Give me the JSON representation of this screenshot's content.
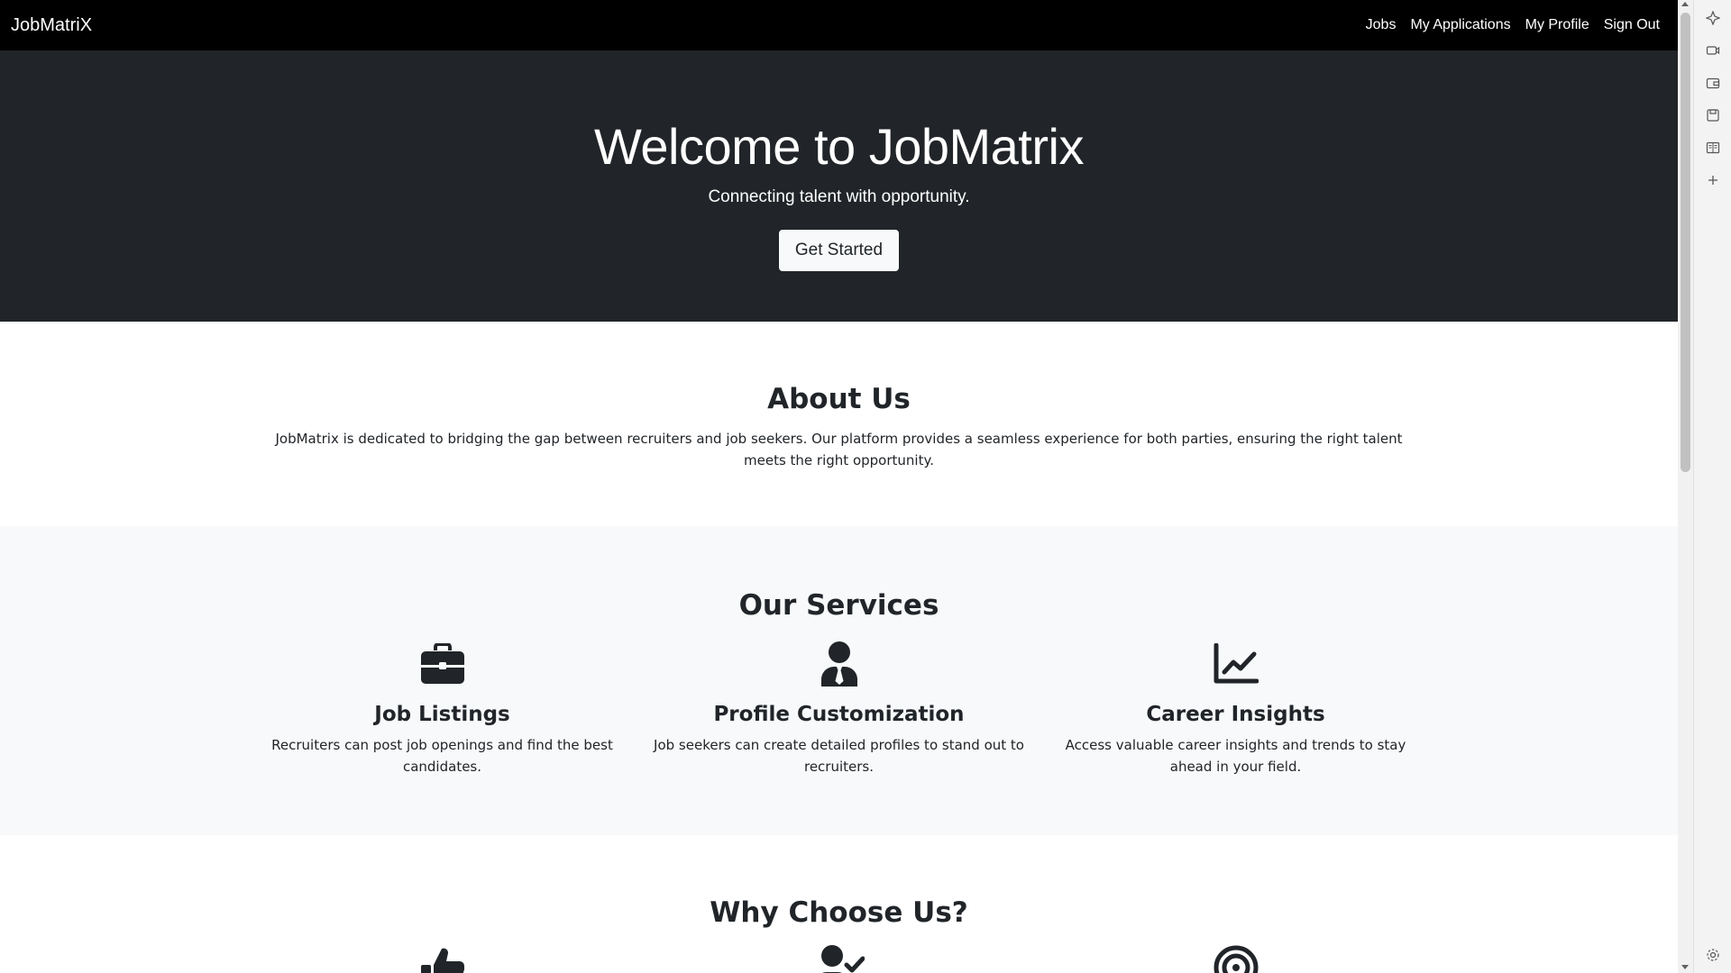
{
  "navbar": {
    "brand": "JobMatriX",
    "links": [
      "Jobs",
      "My Applications",
      "My Profile",
      "Sign Out"
    ]
  },
  "hero": {
    "title": "Welcome to JobMatrix",
    "subtitle": "Connecting talent with opportunity.",
    "cta_label": "Get Started"
  },
  "about": {
    "title": "About Us",
    "text": "JobMatrix is dedicated to bridging the gap between recruiters and job seekers. Our platform provides a seamless experience for both parties, ensuring the right talent meets the right opportunity."
  },
  "services": {
    "title": "Our Services",
    "items": [
      {
        "icon": "briefcase-icon",
        "title": "Job Listings",
        "text": "Recruiters can post job openings and find the best candidates."
      },
      {
        "icon": "person-tie-icon",
        "title": "Profile Customization",
        "text": "Job seekers can create detailed profiles to stand out to recruiters."
      },
      {
        "icon": "line-chart-icon",
        "title": "Career Insights",
        "text": "Access valuable career insights and trends to stay ahead in your field."
      }
    ]
  },
  "why": {
    "title": "Why Choose Us?",
    "icons": [
      "thumbs-up-icon",
      "user-check-icon",
      "target-icon"
    ]
  },
  "colors": {
    "navbar_bg": "#000000",
    "hero_bg": "#212529",
    "services_bg": "#f8f9fa",
    "text": "#212529"
  },
  "sidebar_icons": [
    "copilot-icon",
    "media-icon",
    "wallet-icon",
    "save-icon",
    "reading-icon",
    "add-icon",
    "settings-icon"
  ]
}
